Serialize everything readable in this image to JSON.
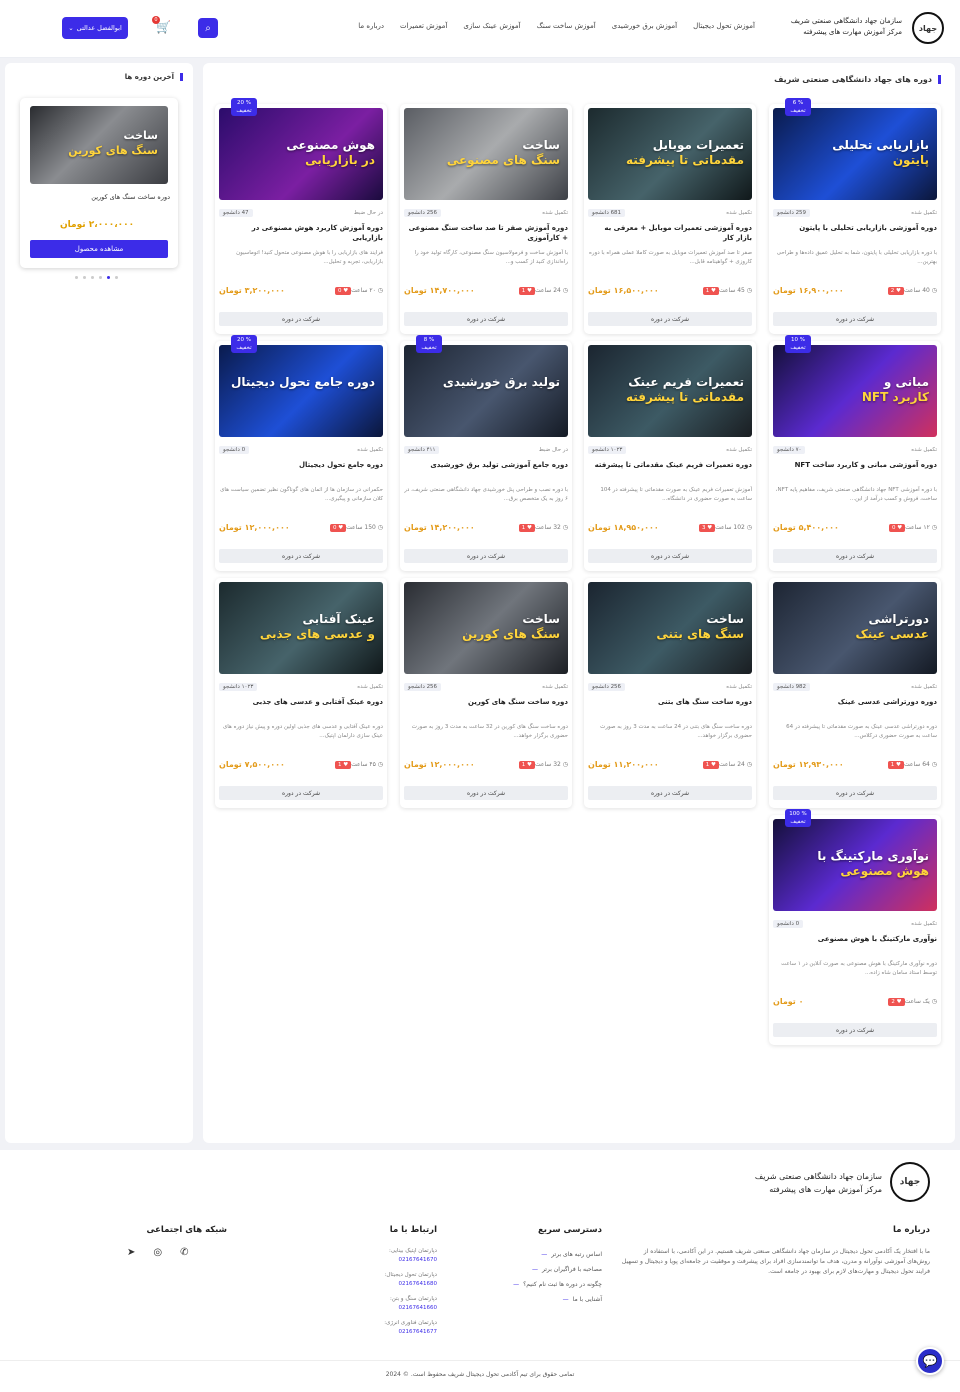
{
  "header": {
    "brand_line1": "سازمان جهاد دانشگاهی صنعتی شریف",
    "brand_line2": "مرکز آموزش مهارت های پیشرفته",
    "logo_text": "جهاد",
    "nav": [
      "آموزش تحول دیجیتال",
      "آموزش برق خورشیدی",
      "آموزش ساخت سنگ",
      "آموزش عینک سازی",
      "آموزش تعمیرات",
      "درباره ما"
    ],
    "cart_count": "0",
    "user_label": "ابوالفضل عدالتی",
    "accent": "#3c2ce8"
  },
  "sidebar": {
    "title": "آخرین دوره ها",
    "card": {
      "thumb_line1": "ساخت",
      "thumb_line2": "سنگ های کورین",
      "course": "دوره ساخت سنگ های کورین",
      "price": "۲،۰۰۰،۰۰۰ تومان",
      "button": "مشاهده محصول"
    }
  },
  "main": {
    "title": "دوره های جهاد دانشگاهی صنعتی شریف",
    "courses": [
      {
        "discount": "% 6",
        "disc_label": "تخفیف",
        "thumb1": "بازاریابی تحلیلی",
        "thumb2": "پایتون",
        "status": "تکمیل شده",
        "students": "259 دانشجو",
        "title": "دوره آموزشی بازاریابی تحلیلی با پایتون",
        "desc": "با دوره بازاریابی تحلیلی با پایتون، شما به تحلیل عمیق داده‌ها و طراحی بهترین...",
        "hours": "40 ساعت",
        "likes": "2",
        "price": "۱۶,۹۰۰,۰۰۰ تومان",
        "enroll": "شرکت در دوره"
      },
      {
        "discount": "",
        "disc_label": "",
        "thumb1": "تعمیرات موبایل",
        "thumb2": "مقدماتی تا پیشرفته",
        "status": "تکمیل شده",
        "students": "681 دانشجو",
        "title": "دوره آموزشی تعمیرات موبایل + معرفی به بازار کار",
        "desc": "صفر تا صد آموزش تعمیرات موبایل به صورت کاملا عملی همراه با دوره کاروزی + گواهینامه قابل...",
        "hours": "45 ساعت",
        "likes": "1",
        "price": "۱۶,۵۰۰,۰۰۰ تومان",
        "enroll": "شرکت در دوره"
      },
      {
        "discount": "",
        "disc_label": "",
        "thumb1": "ساخت",
        "thumb2": "سنگ های مصنوعی",
        "status": "تکمیل شده",
        "students": "256 دانشجو",
        "title": "دوره آموزش صفر تا صد ساخت سنگ مصنوعی + کارآموزی",
        "desc": "با آموزش ساخت و فرمولاسیون سنگ مصنوعی، کارگاه تولید خود را راه‌اندازی کنید از کسب و...",
        "hours": "24 ساعت",
        "likes": "1",
        "price": "۱۴,۷۰۰,۰۰۰ تومان",
        "enroll": "شرکت در دوره"
      },
      {
        "discount": "% 20",
        "disc_label": "تخفیف",
        "thumb1": "هوش مصنوعی",
        "thumb2": "در بازاریابی",
        "status": "در حال ضبط",
        "students": "47 دانشجو",
        "title": "دوره آموزش کاربرد هوش مصنوعی در بازاریابی",
        "desc": "فرایند های بازاریابی را با هوش مصنوعی متحول کنید! اتوماسیون بازاریابی، تجربه و تحلیل...",
        "hours": "۲۰ ساعت",
        "likes": "0",
        "price": "۳,۲۰۰,۰۰۰ تومان",
        "enroll": "شرکت در دوره"
      },
      {
        "discount": "% 10",
        "disc_label": "تخفیف",
        "thumb1": "مبانی و",
        "thumb2": "کاربرد NFT",
        "status": "تکمیل شده",
        "students": "۷۰ دانشجو",
        "title": "دوره آموزشی مبانی و کاربرد ساخت NFT",
        "desc": "با دوره آموزشی NFT جهاد دانشگاهی صنعتی شریف، مفاهیم پایه NFT، ساخت، فروش و کسب درآمد از این...",
        "hours": "۱۲ ساعت",
        "likes": "0",
        "price": "۵,۴۰۰,۰۰۰ تومان",
        "enroll": "شرکت در دوره"
      },
      {
        "discount": "",
        "disc_label": "",
        "thumb1": "تعمیرات فریم عینک",
        "thumb2": "مقدماتی تا پیشرفته",
        "status": "تکمیل شده",
        "students": "۱۰۲۳ دانشجو",
        "title": "دوره تعمیرات فریم عینک مقدماتی تا پیشرفته",
        "desc": "آموزش تعمیرات فریم عینک به صورت مقدماتی تا پیشرفته در 104 ساعت به صورت حضوری در دانشگاه...",
        "hours": "102 ساعت",
        "likes": "3",
        "price": "۱۸,۹۵۰,۰۰۰ تومان",
        "enroll": "شرکت در دوره"
      },
      {
        "discount": "% 8",
        "disc_label": "تخفیف",
        "thumb1": "تولید برق خورشیدی",
        "thumb2": "",
        "status": "در حال ضبط",
        "students": "۴۱۱ دانشجو",
        "title": "دوره جامع آموزشی تولید برق خورشیدی",
        "desc": "با دوره نصب و طراحی پنل خورشیدی جهاد دانشگاهی صنعتی شریف، در ۶ روز به یک متخصص برق...",
        "hours": "32 ساعت",
        "likes": "1",
        "price": "۱۴,۲۰۰,۰۰۰ تومان",
        "enroll": "شرکت در دوره"
      },
      {
        "discount": "% 20",
        "disc_label": "تخفیف",
        "thumb1": "دوره جامع تحول دیجیتال",
        "thumb2": "",
        "status": "تکمیل شده",
        "students": "0 دانشجو",
        "title": "دوره جامع تحول دیجیتال",
        "desc": "حکمرانی در سازمان ها از اثمان های گوناگون نظیر تضمین سیاست های کلان سازمانی و پیگیری...",
        "hours": "150 ساعت",
        "likes": "0",
        "price": "۱۲,۰۰۰,۰۰۰ تومان",
        "enroll": "شرکت در دوره"
      },
      {
        "discount": "",
        "disc_label": "",
        "thumb1": "دورتراشی",
        "thumb2": "عدسی عینک",
        "status": "تکمیل شده",
        "students": "982 دانشجو",
        "title": "دوره دورتراشی عدسی عینک",
        "desc": "دوره دورتراشی عدسی عینک به صورت مقدماتی تا پیشرفته در 64 ساعت به صورت حضوری درکلاس...",
        "hours": "64 ساعت",
        "likes": "1",
        "price": "۱۲,۹۳۰,۰۰۰ تومان",
        "enroll": "شرکت در دوره"
      },
      {
        "discount": "",
        "disc_label": "",
        "thumb1": "ساخت",
        "thumb2": "سنگ های بتنی",
        "status": "تکمیل شده",
        "students": "256 دانشجو",
        "title": "دوره ساخت سنگ های بتنی",
        "desc": "دوره ساخت سنگ های بتنی در 24 ساعت به مدت 3 روز به صورت حضوری برگزار خواهد...",
        "hours": "24 ساعت",
        "likes": "1",
        "price": "۱۱,۲۰۰,۰۰۰ تومان",
        "enroll": "شرکت در دوره"
      },
      {
        "discount": "",
        "disc_label": "",
        "thumb1": "ساخت",
        "thumb2": "سنگ های کورین",
        "status": "تکمیل شده",
        "students": "256 دانشجو",
        "title": "دوره ساخت سنگ های کورین",
        "desc": "دوره ساخت سنگ های کورین در 32 ساعت به مدت 3 روز به صورت حضوری برگزار خواهد...",
        "hours": "32 ساعت",
        "likes": "1",
        "price": "۱۲,۰۰۰,۰۰۰ تومان",
        "enroll": "شرکت در دوره"
      },
      {
        "discount": "",
        "disc_label": "",
        "thumb1": "عینک آفتابی",
        "thumb2": "و عدسی های جذبی",
        "status": "تکمیل شده",
        "students": "۱۰۲۳ دانشجو",
        "title": "دوره عینک آفتابی و عدسی های جذبی",
        "desc": "دوره عینک آفتابی و عدسی های جذبی اولین دوره و پیش نیاز دوره های عینک سازی دارلمان اپتیک...",
        "hours": "۴۵ ساعت",
        "likes": "1",
        "price": "۷,۵۰۰,۰۰۰ تومان",
        "enroll": "شرکت در دوره"
      },
      {
        "discount": "% 100",
        "disc_label": "تخفیف",
        "thumb1": "نوآوری مارکتینگ با",
        "thumb2": "هوش مصنوعی",
        "status": "تکمیل شده",
        "students": "0 دانشجو",
        "title": "نوآوری مارکتینگ با هوش مصنوعی",
        "desc": "دوره نوآوری مارکتینگ با هوش مصنوعی به صورت آنلاین در ۱ ساعت توسط استاد سامان شاه زاده...",
        "hours": "یک ساعت",
        "likes": "2",
        "price": "۰ تومان",
        "enroll": "شرکت در دوره"
      }
    ]
  },
  "footer": {
    "logo_text": "جهاد",
    "brand_line1": "سازمان جهاد دانشگاهی صنعتی شریف",
    "brand_line2": "مرکز آموزش مهارت های پیشرفته",
    "about_title": "درباره ما",
    "about_text": "ما با افتخار یک آکادمی تحول دیجیتال در سازمان جهاد دانشگاهی صنعتی شریف هستیم. در این آکادمی، با استفاده از روش‌های آموزشی نوآورانه و مدرن، هدف ما توانمندسازی افراد برای پیشرفت و موفقیت در جامعه‌ای پویا و دیجیتال و تسهیل فرایند تحول دیجیتال و مهارت‌های لازم برای بهبود در جامعه است.",
    "quick_title": "دسترسی سریع",
    "quick_links": [
      "اساس رتبه های برتر",
      "مصاحبه با فراگیران برتر",
      "چگونه در دوره ها ثبت نام کنیم؟",
      "آشنایی با ما"
    ],
    "contact_title": "ارتباط با ما",
    "contacts": [
      {
        "label": "دپارتمان اپتیک بینایی:",
        "number": "02167641670"
      },
      {
        "label": "دپارتمان تحول دیجیتال:",
        "number": "02167641680"
      },
      {
        "label": "دپارتمان سنگ و بتن:",
        "number": "02167641660"
      },
      {
        "label": "دپارتمان فناوری انرژی:",
        "number": "02167641677"
      }
    ],
    "social_title": "شبکه های اجتماعی",
    "copyright": "تمامی حقوق برای تیم آکادمی تحول دیجیتال شریف محفوظ است. © 2024"
  }
}
